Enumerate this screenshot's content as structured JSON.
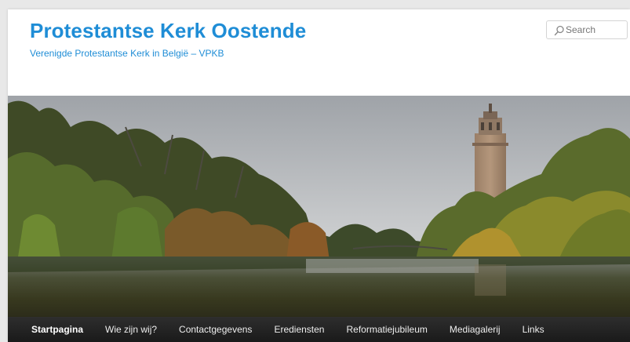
{
  "site": {
    "title": "Protestantse Kerk Oostende",
    "description": "Verenigde Protestantse Kerk in België – VPKB"
  },
  "search": {
    "placeholder": "Search",
    "icon": "search-icon"
  },
  "header_image": {
    "subject": "pond with autumn trees and a brick water tower"
  },
  "nav": {
    "items": [
      {
        "label": "Startpagina",
        "active": true
      },
      {
        "label": "Wie zijn wij?",
        "active": false
      },
      {
        "label": "Contactgegevens",
        "active": false
      },
      {
        "label": "Erediensten",
        "active": false
      },
      {
        "label": "Reformatiejubileum",
        "active": false
      },
      {
        "label": "Mediagalerij",
        "active": false
      },
      {
        "label": "Links",
        "active": false
      }
    ]
  },
  "colors": {
    "brand": "#1f8dd6",
    "nav_background": "#222222",
    "nav_text": "#eeeeee"
  }
}
